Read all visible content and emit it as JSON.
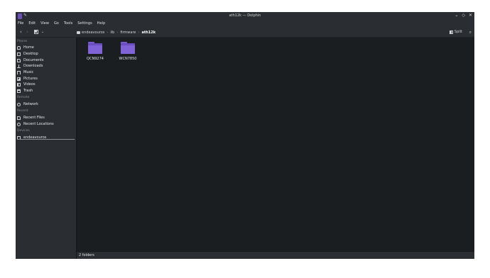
{
  "window": {
    "title": "ath12k — Dolphin",
    "controls": [
      "⌄",
      "◇",
      "✕"
    ]
  },
  "menubar": [
    "File",
    "Edit",
    "View",
    "Go",
    "Tools",
    "Settings",
    "Help"
  ],
  "toolbar": {
    "back": "‹",
    "forward": "›",
    "view_dropdown": "⌄",
    "breadcrumb": [
      "endeavouros",
      "lib",
      "firmware",
      "ath12k"
    ],
    "split_label": "Split",
    "search_icon": "⌕"
  },
  "sidebar": {
    "sections": {
      "places": "Places",
      "remote": "Remote",
      "recent": "Recent",
      "devices": "Devices"
    },
    "places": [
      "Home",
      "Desktop",
      "Documents",
      "Downloads",
      "Music",
      "Pictures",
      "Videos",
      "Trash"
    ],
    "remote": [
      "Network"
    ],
    "recent": [
      "Recent Files",
      "Recent Locations"
    ],
    "devices": [
      "endeavouros"
    ]
  },
  "files": [
    {
      "name": "QCN9274",
      "type": "folder"
    },
    {
      "name": "WCN7850",
      "type": "folder"
    }
  ],
  "status": "2 folders",
  "colors": {
    "folder_accent": "#7a5cd0",
    "background": "#1b1e20",
    "chrome": "#2a2e32"
  }
}
